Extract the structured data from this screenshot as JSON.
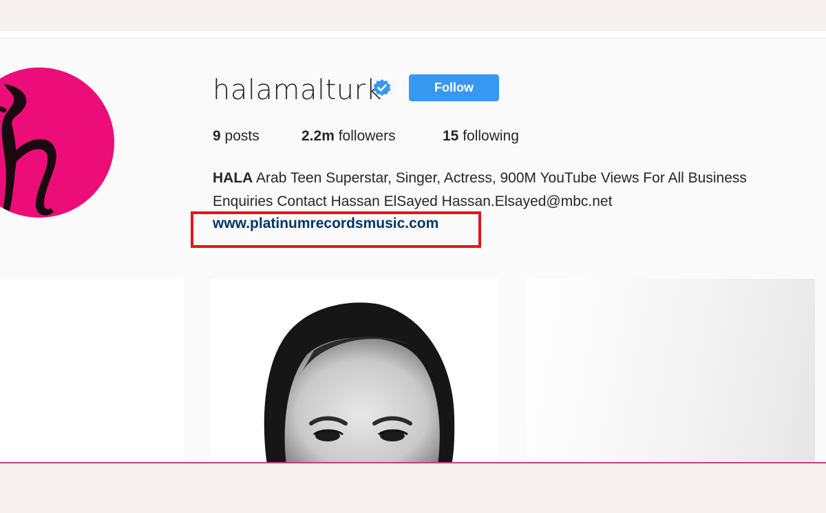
{
  "profile": {
    "username": "halamalturk",
    "follow_label": "Follow",
    "stats": {
      "posts_count": "9",
      "posts_label": "posts",
      "followers_count": "2.2m",
      "followers_label": "followers",
      "following_count": "15",
      "following_label": "following"
    },
    "bio": {
      "name": "HALA",
      "text": "Arab Teen Superstar, Singer, Actress, 900M YouTube Views For All Business Enquiries Contact Hassan ElSayed Hassan.Elsayed@mbc.net",
      "link": "www.platinumrecordsmusic.com"
    }
  },
  "colors": {
    "follow_button": "#3897f0",
    "verified_badge": "#3897f0",
    "avatar_bg": "#ec0d79",
    "link": "#003569",
    "highlight": "#e1151f",
    "bottom_rule": "#c43c8a"
  },
  "icons": {
    "verified": "verified-badge-icon"
  }
}
